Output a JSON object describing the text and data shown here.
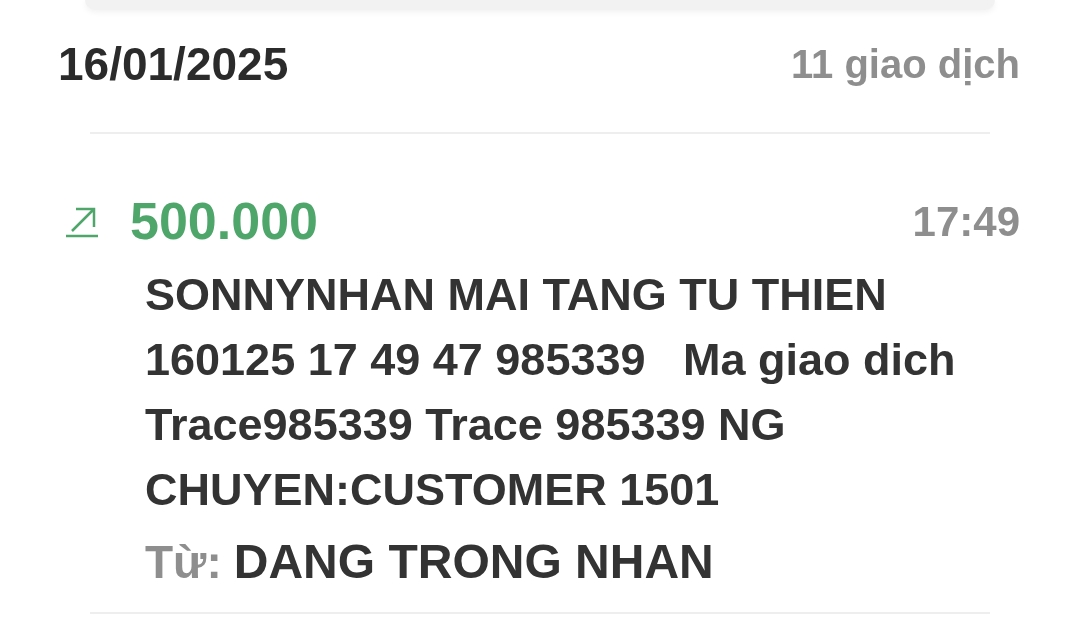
{
  "date_header": {
    "date": "16/01/2025",
    "count": "11 giao dịch"
  },
  "transactions": [
    {
      "kind": "in",
      "amount": "500.000",
      "time": "17:49",
      "description": "SONNYNHAN MAI TANG TU THIEN 160125 17 49 47 985339   Ma giao dich  Trace985339 Trace 985339 NG CHUYEN:CUSTOMER 1501",
      "from_label": "Từ:",
      "from_name": "DANG TRONG NHAN"
    }
  ]
}
